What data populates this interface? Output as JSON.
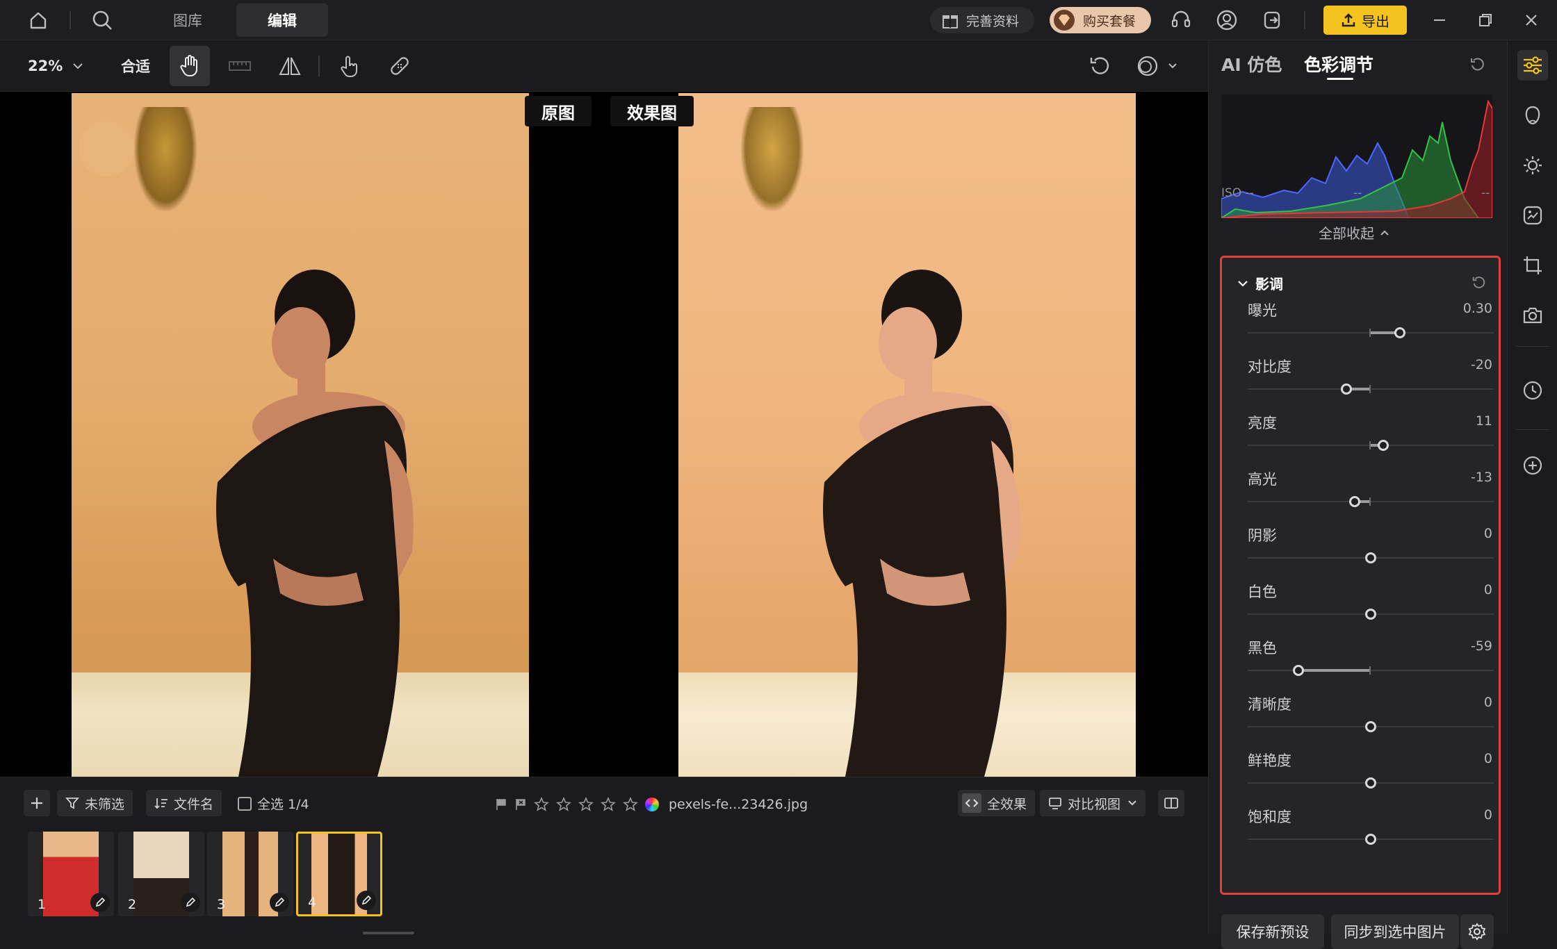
{
  "top": {
    "tabs": [
      "图库",
      "编辑"
    ],
    "complete_profile": "完善资料",
    "buy_package": "购买套餐",
    "export": "导出"
  },
  "toolbar": {
    "zoom": "22%",
    "fit": "合适"
  },
  "canvas": {
    "original_label": "原图",
    "effect_label": "效果图"
  },
  "filmstrip": {
    "filter": "未筛选",
    "sort": "文件名",
    "select_all": "全选 1/4",
    "filename": "pexels-fe...23426.jpg",
    "all_effects": "全效果",
    "compare_view": "对比视图",
    "thumbnails": [
      {
        "num": "1",
        "selected": false
      },
      {
        "num": "2",
        "selected": false
      },
      {
        "num": "3",
        "selected": false
      },
      {
        "num": "4",
        "selected": true
      }
    ]
  },
  "panel": {
    "tabs": [
      "AI 仿色",
      "色彩调节"
    ],
    "iso": "ISO --",
    "dash1": "--",
    "dash2": "--",
    "collapse_all": "全部收起",
    "section_title": "影调",
    "sliders": [
      {
        "label": "曝光",
        "value": "0.30",
        "pos": 0.62
      },
      {
        "label": "对比度",
        "value": "-20",
        "pos": 0.4
      },
      {
        "label": "亮度",
        "value": "11",
        "pos": 0.55
      },
      {
        "label": "高光",
        "value": "-13",
        "pos": 0.435
      },
      {
        "label": "阴影",
        "value": "0",
        "pos": 0.5
      },
      {
        "label": "白色",
        "value": "0",
        "pos": 0.5
      },
      {
        "label": "黑色",
        "value": "-59",
        "pos": 0.205
      },
      {
        "label": "清晰度",
        "value": "0",
        "pos": 0.5
      },
      {
        "label": "鲜艳度",
        "value": "0",
        "pos": 0.5
      },
      {
        "label": "饱和度",
        "value": "0",
        "pos": 0.5
      }
    ],
    "save_preset": "保存新预设",
    "sync": "同步到选中图片"
  },
  "colors": {
    "accent_yellow": "#f5c31f",
    "highlight_red": "#e0413a"
  }
}
